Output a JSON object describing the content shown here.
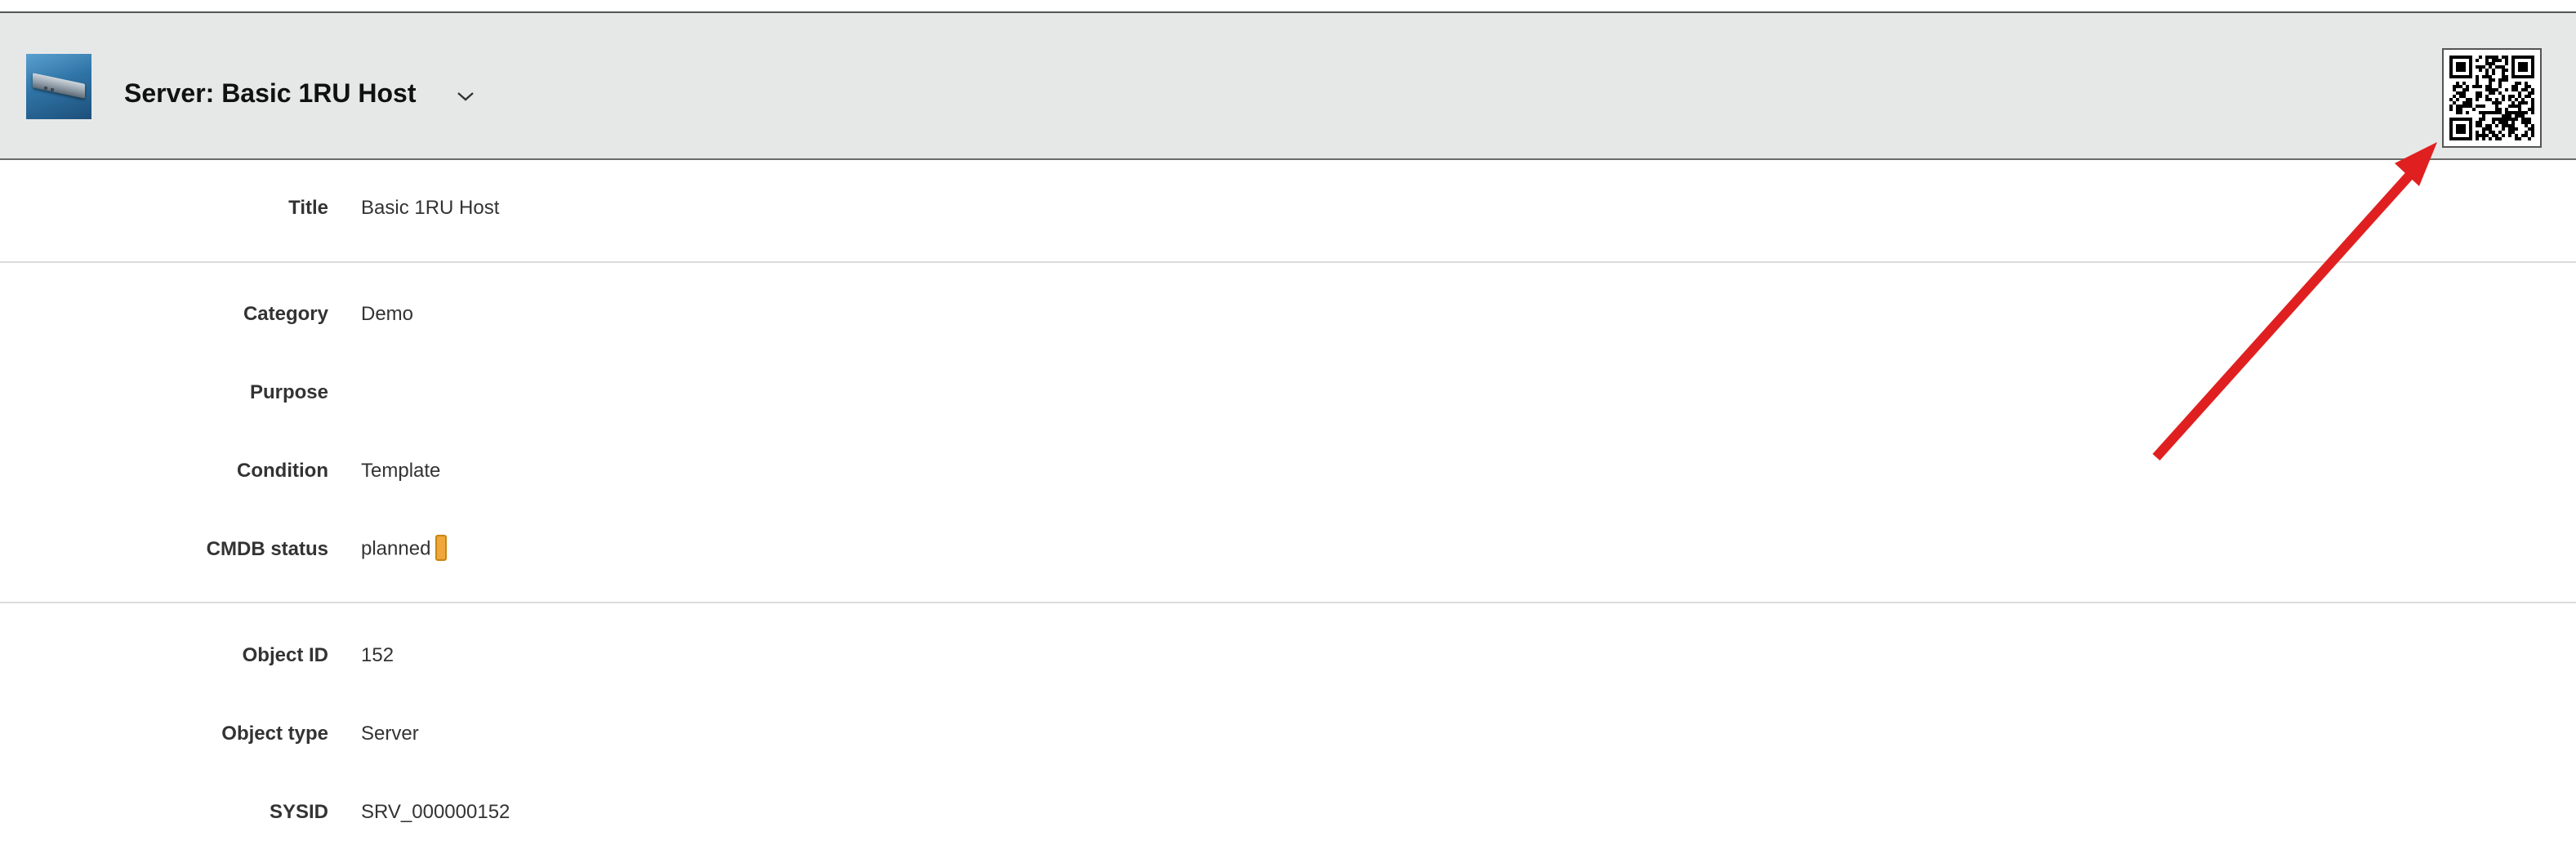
{
  "header": {
    "title": "Server: Basic 1RU Host",
    "icon": "server-rack-icon",
    "dropdown_icon": "chevron-down-icon",
    "qr_icon": "qr-code-icon"
  },
  "fields": {
    "title": {
      "label": "Title",
      "value": "Basic 1RU Host"
    },
    "category": {
      "label": "Category",
      "value": "Demo"
    },
    "purpose": {
      "label": "Purpose",
      "value": ""
    },
    "condition": {
      "label": "Condition",
      "value": "Template"
    },
    "cmdb_status": {
      "label": "CMDB status",
      "value": "planned",
      "color": "#f0a63a"
    },
    "object_id": {
      "label": "Object ID",
      "value": "152"
    },
    "object_type": {
      "label": "Object type",
      "value": "Server"
    },
    "sysid": {
      "label": "SYSID",
      "value": "SRV_000000152"
    }
  },
  "annotation": {
    "color": "#e02020",
    "icon": "arrow-annotation"
  }
}
